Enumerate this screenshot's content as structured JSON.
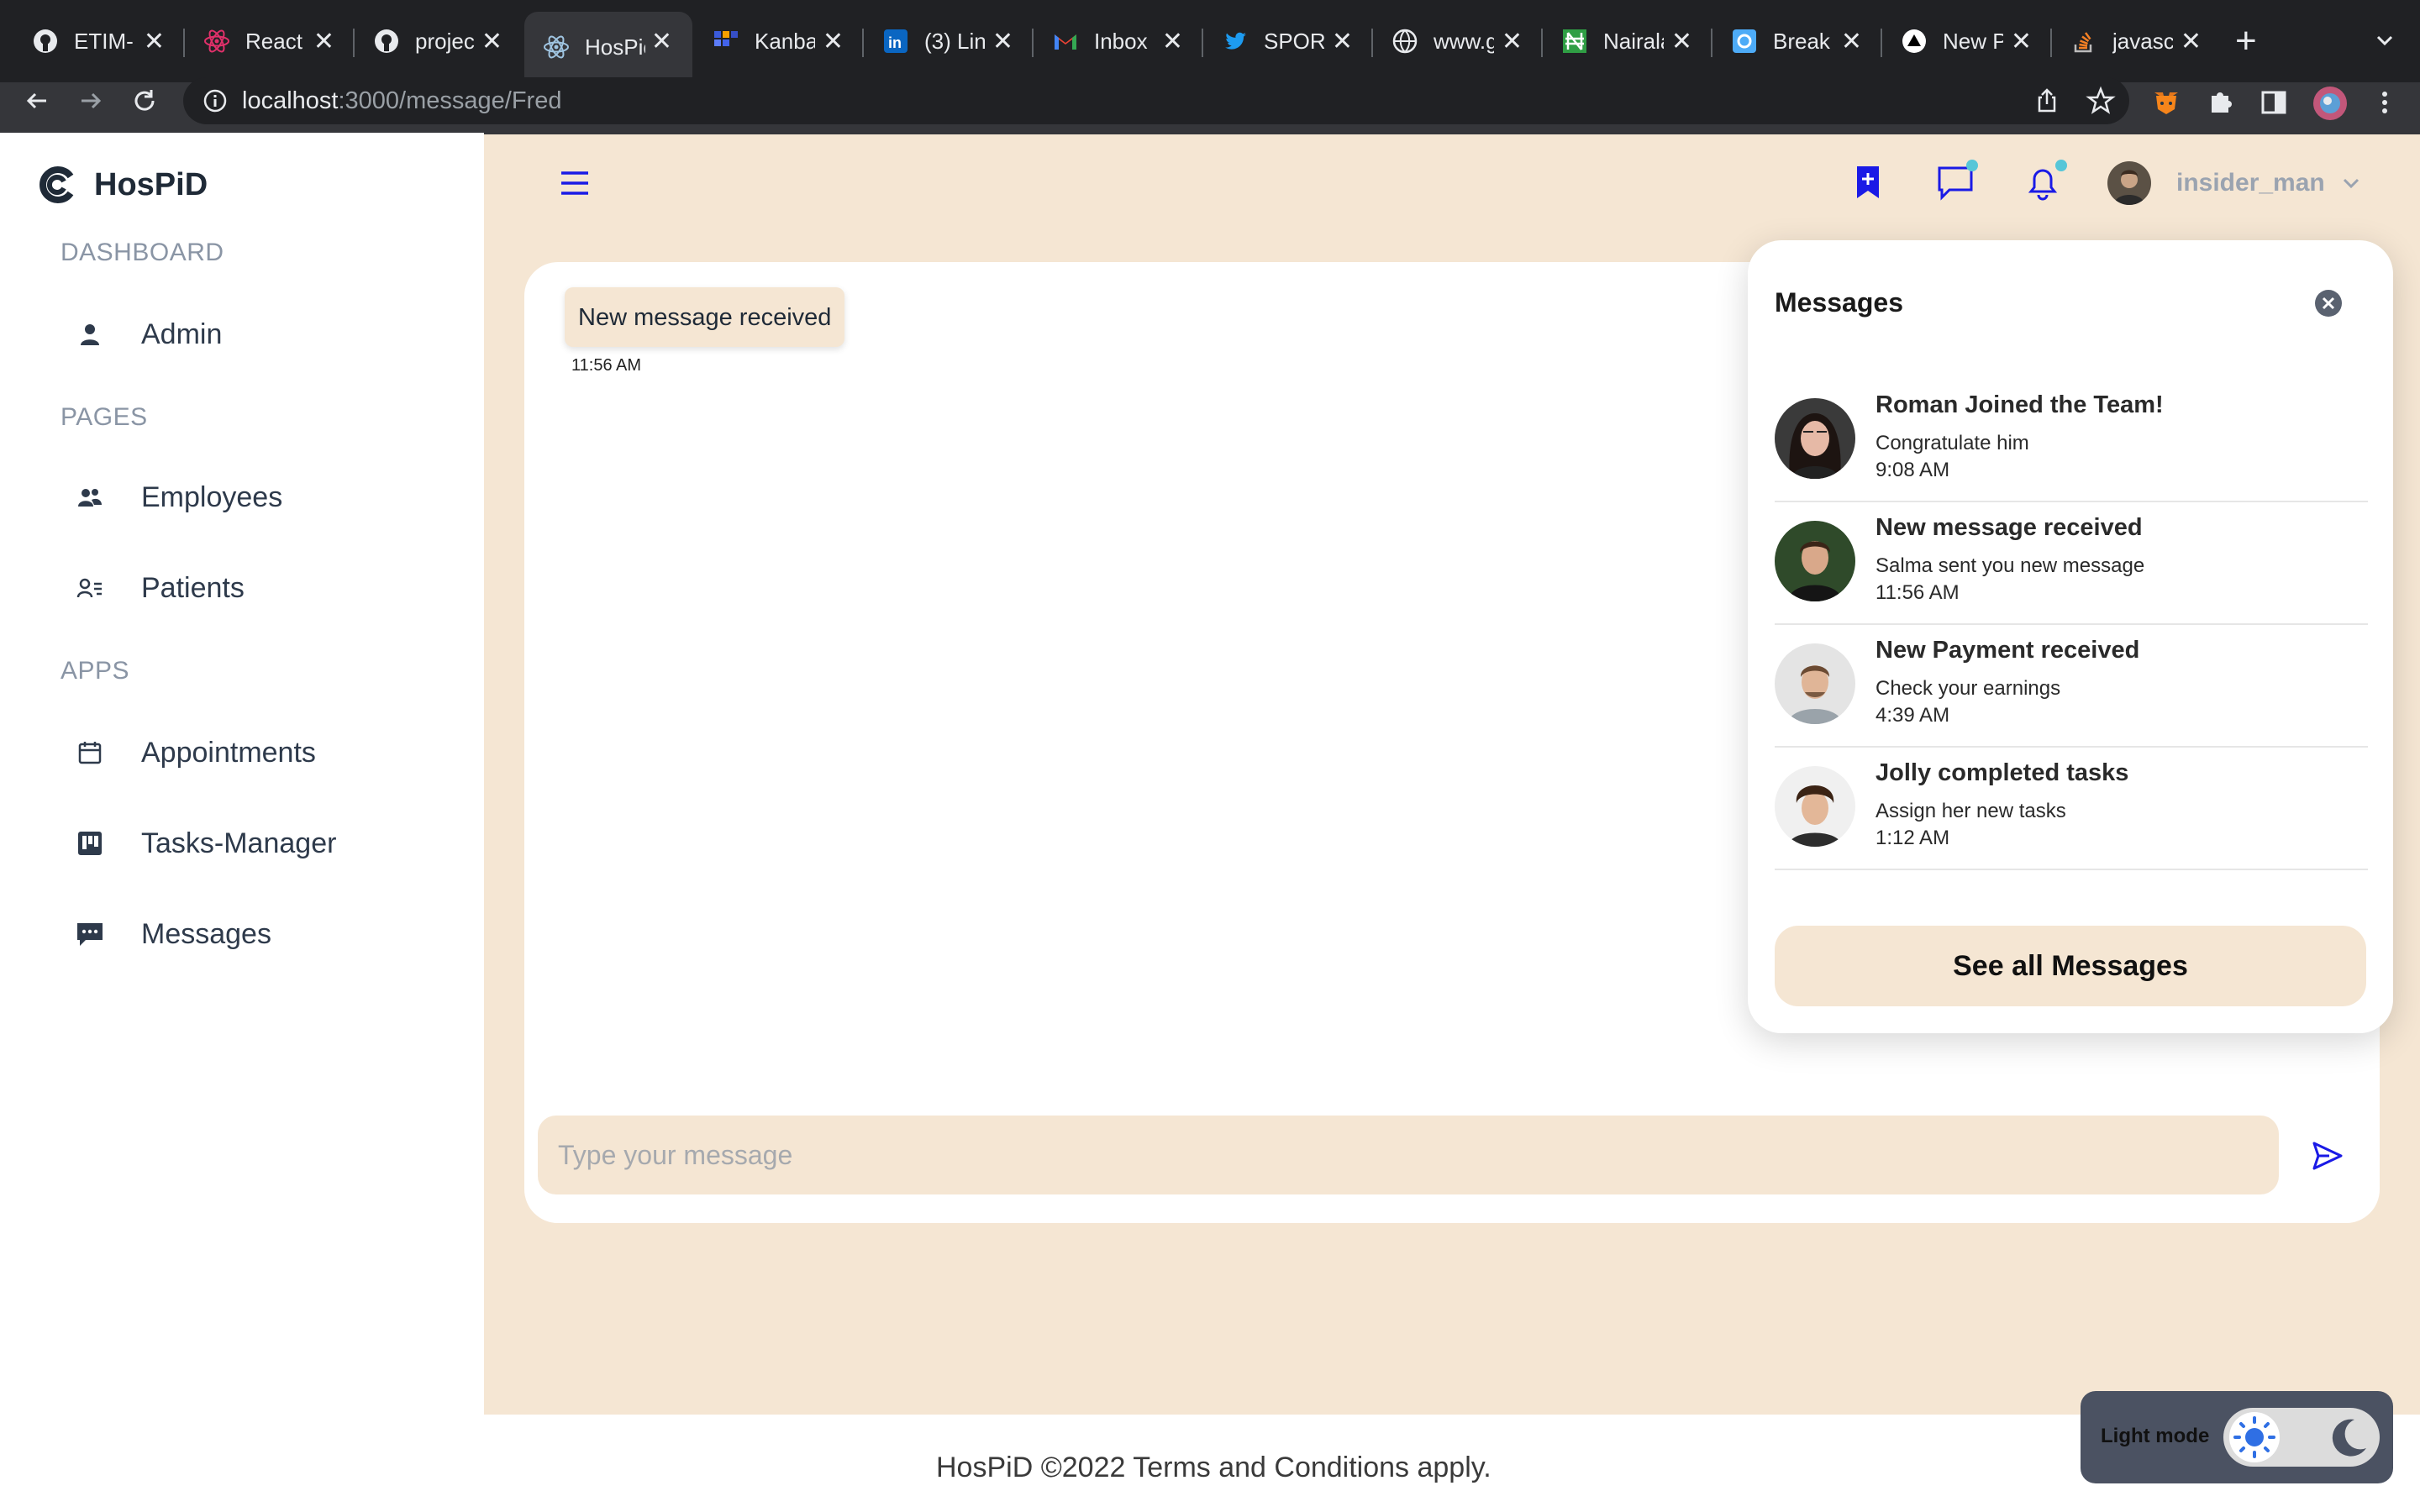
{
  "browser": {
    "tabs": [
      {
        "title": "ETIM-I",
        "icon": "github-icon"
      },
      {
        "title": "React",
        "icon": "react-icon"
      },
      {
        "title": "projec",
        "icon": "github-icon"
      },
      {
        "title": "HosPic",
        "icon": "react-icon",
        "active": true
      },
      {
        "title": "Kanba",
        "icon": "kanban-icon"
      },
      {
        "title": "(3) Lin",
        "icon": "linkedin-icon"
      },
      {
        "title": "Inbox (",
        "icon": "gmail-icon"
      },
      {
        "title": "SPORT",
        "icon": "twitter-icon"
      },
      {
        "title": "www.g",
        "icon": "globe-icon"
      },
      {
        "title": "Nairala",
        "icon": "nairaland-icon"
      },
      {
        "title": "Break",
        "icon": "breakthrough-icon"
      },
      {
        "title": "New P",
        "icon": "vercel-icon"
      },
      {
        "title": "javasc",
        "icon": "stackoverflow-icon"
      }
    ],
    "url_host": "localhost",
    "url_rest": ":3000/message/Fred"
  },
  "sidebar": {
    "brand": "HosPiD",
    "sections": {
      "dashboard": "DASHBOARD",
      "pages": "PAGES",
      "apps": "APPS"
    },
    "items": {
      "admin": "Admin",
      "employees": "Employees",
      "patients": "Patients",
      "appointments": "Appointments",
      "tasks": "Tasks-Manager",
      "messages": "Messages"
    }
  },
  "header": {
    "username": "insider_man"
  },
  "chat": {
    "bubble_text": "New message received",
    "bubble_time": "11:56 AM",
    "input_placeholder": "Type your message"
  },
  "dropdown": {
    "title": "Messages",
    "items": [
      {
        "title": "Roman Joined the Team!",
        "subtitle": "Congratulate him",
        "time": "9:08 AM"
      },
      {
        "title": "New message received",
        "subtitle": "Salma sent you new message",
        "time": "11:56 AM"
      },
      {
        "title": "New Payment received",
        "subtitle": "Check your earnings",
        "time": "4:39 AM"
      },
      {
        "title": "Jolly completed tasks",
        "subtitle": "Assign her new tasks",
        "time": "1:12 AM"
      }
    ],
    "see_all": "See all Messages"
  },
  "footer": {
    "text": "HosPiD ©2022 Terms and Conditions apply."
  },
  "theme": {
    "mode_label": "Light mode",
    "accent": "#1a1ae6",
    "background": "#f5e6d3"
  }
}
